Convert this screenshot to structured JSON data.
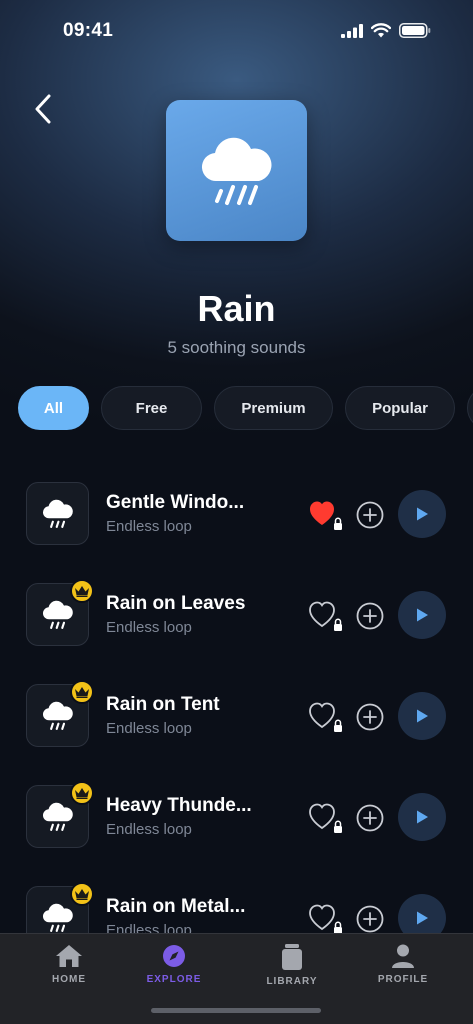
{
  "status": {
    "time": "09:41"
  },
  "header": {
    "title": "Rain",
    "subtitle": "5 soothing sounds"
  },
  "filters": [
    {
      "label": "All",
      "active": true
    },
    {
      "label": "Free",
      "active": false
    },
    {
      "label": "Premium",
      "active": false
    },
    {
      "label": "Popular",
      "active": false
    },
    {
      "label": "",
      "active": false
    }
  ],
  "sounds": [
    {
      "title": "Gentle Windo...",
      "subtitle": "Endless loop",
      "premium": false,
      "favorited": true,
      "icon": "cloud-rain-icon"
    },
    {
      "title": "Rain on Leaves",
      "subtitle": "Endless loop",
      "premium": true,
      "favorited": false,
      "icon": "cloud-rain-icon"
    },
    {
      "title": "Rain on Tent",
      "subtitle": "Endless loop",
      "premium": true,
      "favorited": false,
      "icon": "cloud-rain-icon"
    },
    {
      "title": "Heavy Thunde...",
      "subtitle": "Endless loop",
      "premium": true,
      "favorited": false,
      "icon": "cloud-rain-icon"
    },
    {
      "title": "Rain on Metal...",
      "subtitle": "Endless loop",
      "premium": true,
      "favorited": false,
      "icon": "cloud-rain-icon"
    }
  ],
  "tabs": [
    {
      "label": "HOME",
      "icon": "home-icon",
      "active": false
    },
    {
      "label": "EXPLORE",
      "icon": "compass-icon",
      "active": true
    },
    {
      "label": "LIBRARY",
      "icon": "library-icon",
      "active": false
    },
    {
      "label": "PROFILE",
      "icon": "profile-icon",
      "active": false
    }
  ],
  "colors": {
    "accent": "#6bb6f7",
    "explore": "#7c5ce6",
    "favorite": "#ff3b30",
    "premium": "#f3c218"
  }
}
